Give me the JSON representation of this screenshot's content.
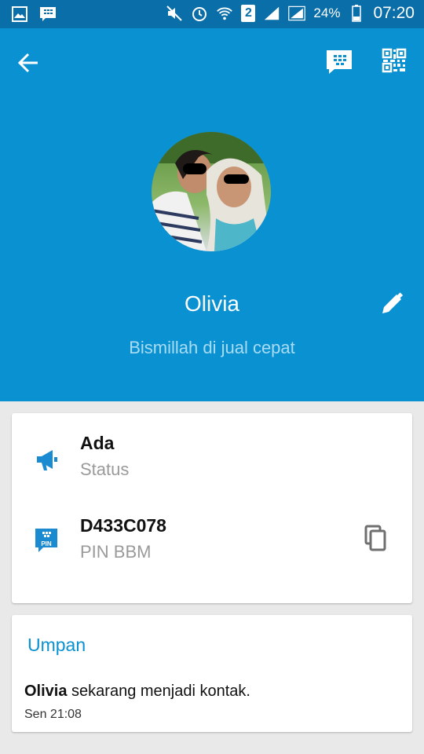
{
  "status_bar": {
    "battery_percent": "24%",
    "time": "07:20",
    "sim_slot": "2",
    "icons": [
      "gallery-icon",
      "bbm-notification-icon",
      "mute-icon",
      "alarm-icon",
      "wifi-icon",
      "sim-icon",
      "signal-icon",
      "signal-icon",
      "battery-icon"
    ]
  },
  "header": {
    "back_icon": "arrow-back-icon",
    "actions": [
      "bbm-chat-icon",
      "qr-code-icon"
    ],
    "background_color": "#0a91d1"
  },
  "profile": {
    "name": "Olivia",
    "message": "Bismillah di jual cepat",
    "edit_icon": "pencil-icon"
  },
  "info_card": {
    "status": {
      "title": "Ada",
      "subtitle": "Status",
      "icon": "megaphone-icon"
    },
    "pin": {
      "title": "D433C078",
      "subtitle": "PIN BBM",
      "icon": "pin-icon",
      "icon_label": "PIN",
      "copy_icon": "copy-icon"
    }
  },
  "feed": {
    "title": "Umpan",
    "items": [
      {
        "name": "Olivia",
        "text": " sekarang menjadi kontak.",
        "time": "Sen 21:08"
      }
    ]
  },
  "colors": {
    "accent": "#0a91d1",
    "status_bar": "#0a6ea8",
    "background": "#e9e9e9"
  }
}
